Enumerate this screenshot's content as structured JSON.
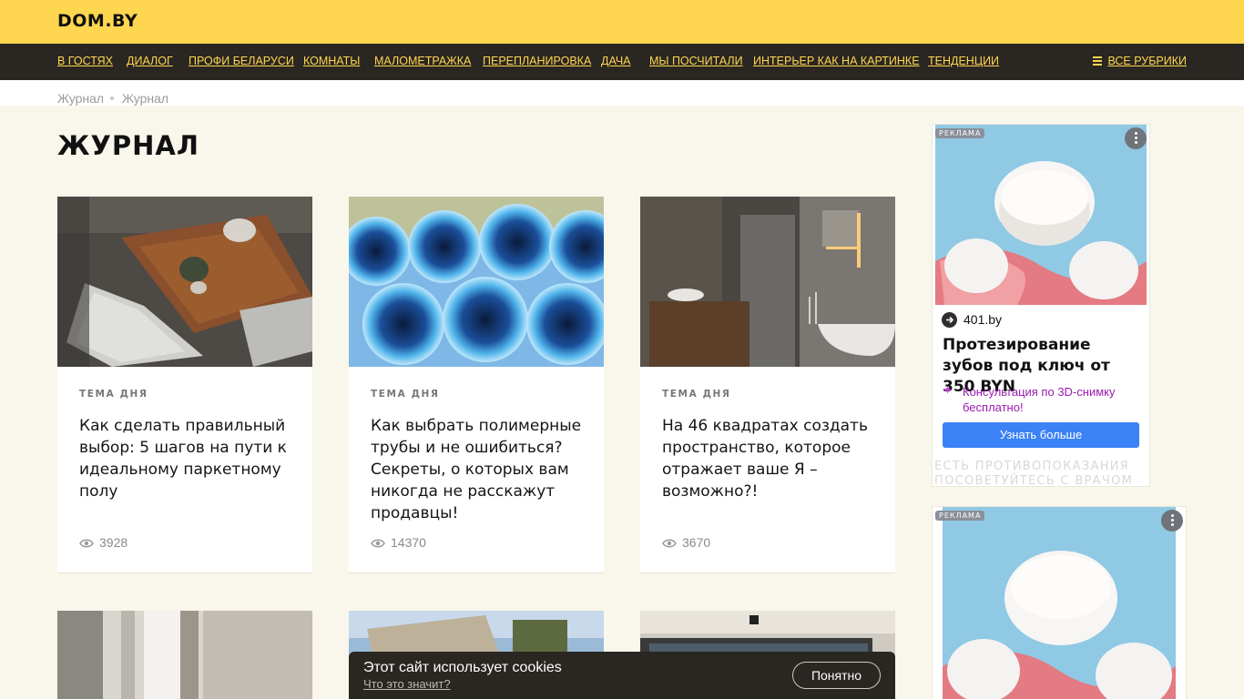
{
  "header": {
    "logo": "DOM.BY"
  },
  "nav": {
    "items": [
      "В гостях",
      "Диалог",
      "Профи Беларуси",
      "Комнаты",
      "Малометражка",
      "Перепланировка",
      "Дача",
      "Мы посчитали",
      "Интерьер как на картинке",
      "Тенденции"
    ],
    "all_label": "ВСЕ РУБРИКИ"
  },
  "breadcrumb": [
    "Журнал",
    "Журнал"
  ],
  "page_title": "ЖУРНАЛ",
  "cards": [
    {
      "tag": "ТЕМА ДНЯ",
      "title": "Как сделать правильный выбор: 5 шагов на пути к идеальному паркетному полу",
      "views": "3928"
    },
    {
      "tag": "ТЕМА ДНЯ",
      "title": "Как выбрать полимерные трубы и не ошибиться? Секреты, о которых вам никогда не расскажут продавцы!",
      "views": "14370"
    },
    {
      "tag": "ТЕМА ДНЯ",
      "title": "На 46 квадратах создать пространство, которое отражает ваше Я – возможно?!",
      "views": "3670"
    }
  ],
  "ads": {
    "badge": "РЕКЛАМА",
    "domain": "401.by",
    "headline": "Протезирование зубов под ключ от 350 BYN",
    "subtitle": "Консультация по 3D-снимку бесплатно!",
    "button": "Узнать больше",
    "warning_line1": "ЕСТЬ ПРОТИВОПОКАЗАНИЯ",
    "warning_line2": "ПОСОВЕТУЙТЕСЬ С ВРАЧОМ"
  },
  "cookie": {
    "text": "Этот сайт использует cookies",
    "link": "Что это значит?",
    "button": "Понятно"
  },
  "colors": {
    "accent_yellow": "#ffd64f",
    "nav_dark": "#2a2622",
    "page_bg": "#f9f6ec",
    "ad_button": "#3b82f6"
  }
}
